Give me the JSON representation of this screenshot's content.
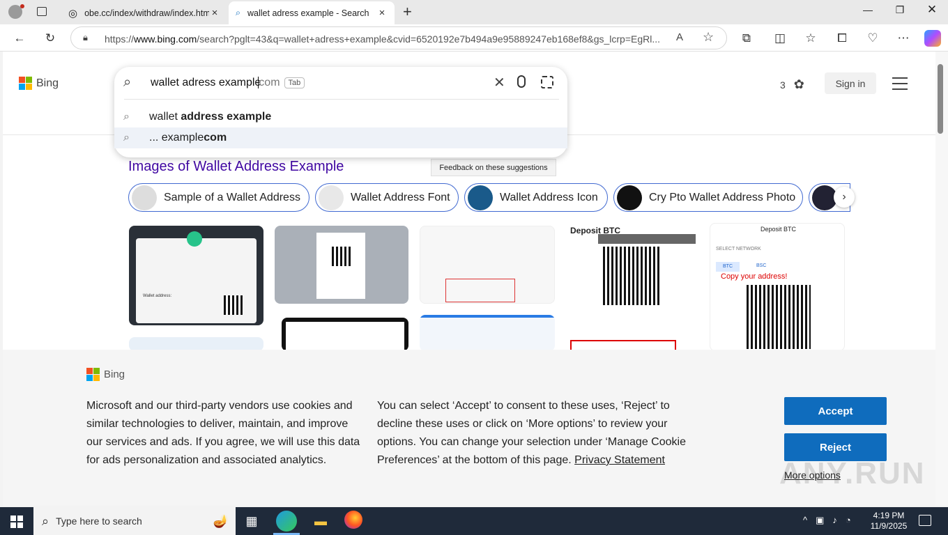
{
  "browser": {
    "tabs": [
      {
        "title": "obe.cc/index/withdraw/index.htm"
      },
      {
        "title": "wallet adress example - Search"
      }
    ],
    "url_prefix": "https://",
    "url_domain": "www.bing.com",
    "url_rest": "/search?pglt=43&q=wallet+adress+example&cvid=6520192e7b494a9e95889247eb168ef8&gs_lcrp=EgRl..."
  },
  "bing": {
    "logo": "Bing",
    "query_typed": "wallet adress example",
    "query_ghost": "com",
    "tab_hint": "Tab",
    "suggestions": [
      {
        "plain": "wallet ",
        "bold": "address example"
      },
      {
        "plain": "... example",
        "bold": "com"
      }
    ],
    "rewards_count": "3",
    "signin": "Sign in",
    "feedback": "Feedback on these suggestions",
    "images_title": "Images of Wallet Address Example",
    "chips": [
      {
        "label": "Sample of a Wallet Address"
      },
      {
        "label": "Wallet Address Font"
      },
      {
        "label": "Wallet Address Icon"
      },
      {
        "label": "Cry Pto Wallet Address Photo"
      }
    ],
    "thumb_texts": {
      "deposit1": "Deposit BTC",
      "deposit2": "Deposit BTC",
      "select_network": "SELECT NETWORK",
      "btc": "BTC",
      "bsc": "BSC",
      "copy": "Copy your address!",
      "wallet_address": "Wallet address:"
    }
  },
  "cookie": {
    "logo": "Bing",
    "text1": "Microsoft and our third-party vendors use cookies and similar technologies to deliver, maintain, and improve our services and ads. If you agree, we will use this data for ads personalization and associated analytics.",
    "text2": "You can select ‘Accept’ to consent to these uses, ‘Reject’ to decline these uses or click on ‘More options’ to review your options. You can change your selection under ‘Manage Cookie Preferences’ at the bottom of this page.",
    "privacy": "Privacy Statement",
    "accept": "Accept",
    "reject": "Reject",
    "more": "More options",
    "watermark": "ANY.RUN"
  },
  "taskbar": {
    "search_placeholder": "Type here to search",
    "time": "4:19 PM",
    "date": "11/9/2025"
  }
}
